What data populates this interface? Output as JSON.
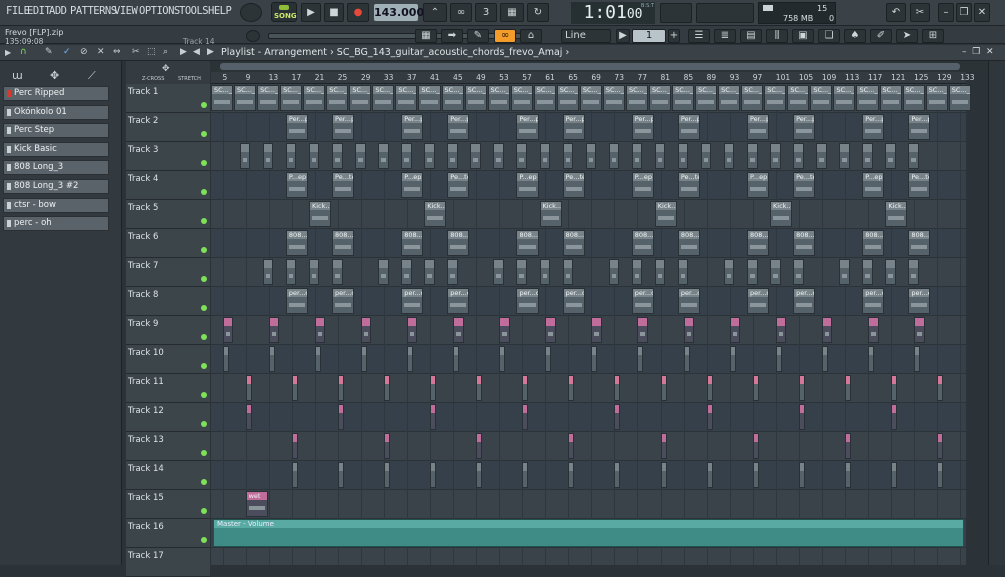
{
  "menu": [
    "FILE",
    "EDIT",
    "ADD",
    "PATTERNS",
    "VIEW",
    "OPTIONS",
    "TOOLS",
    "HELP"
  ],
  "transport": {
    "mode": "SONG",
    "tempo": "143.000",
    "time": "1:01",
    "time_sub": "00",
    "bst": "B:S:T"
  },
  "cpu": {
    "value": "15",
    "memory": "758 MB",
    "voices": "0"
  },
  "project": {
    "filename": "Frevo [FLP].zip",
    "time": "135:09:08",
    "track_hint": "Track 14"
  },
  "snap": {
    "label": "Line",
    "value": "1"
  },
  "playlist": {
    "title": "Playlist - Arrangement",
    "pattern": "SC_BG_143_guitar_acoustic_chords_frevo_Amaj"
  },
  "browser_items": [
    "Perc Ripped",
    "Okónkolo 01",
    "Perc Step",
    "Kick Basic",
    "808 Long_3",
    "808 Long_3 #2",
    "ctsr - bow",
    "perc - oh"
  ],
  "tracks": [
    "Track 1",
    "Track 2",
    "Track 3",
    "Track 4",
    "Track 5",
    "Track 6",
    "Track 7",
    "Track 8",
    "Track 9",
    "Track 10",
    "Track 11",
    "Track 12",
    "Track 13",
    "Track 14",
    "Track 15",
    "Track 16",
    "Track 17"
  ],
  "ruler": [
    "5",
    "9",
    "13",
    "17",
    "21",
    "25",
    "29",
    "33",
    "37",
    "41",
    "45",
    "49",
    "53",
    "57",
    "61",
    "65",
    "69",
    "73",
    "77",
    "81",
    "85",
    "89",
    "93",
    "97",
    "101",
    "105",
    "109",
    "113",
    "117",
    "121",
    "125",
    "129",
    "133"
  ],
  "clip_labels": {
    "t1": "SC..._maj",
    "t2": "Per...ped",
    "t4": "P...ep",
    "t4b": "Pe...tep",
    "t5": "Kick...asic",
    "t6": "808...g_3",
    "t6b": "808...3 #2",
    "t8": "per...oh",
    "t15": "wet",
    "t16": "Master - Volume"
  },
  "ctrl_labels": {
    "zcross": "Z-CROSS",
    "stretch": "STRETCH"
  },
  "colors": {
    "accent": "#f39b2b",
    "clip": "#56626a",
    "purple_clip": "#c06d9c",
    "automation": "#3f8c86",
    "led": "#7fe05a"
  }
}
